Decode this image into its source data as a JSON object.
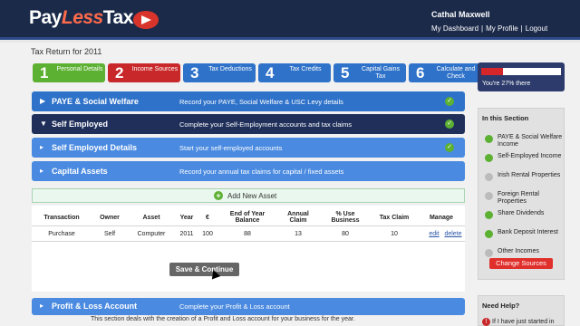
{
  "brand": {
    "pay": "Pay",
    "less": "Less",
    "tax": "Tax"
  },
  "user": {
    "name": "Cathal Maxwell",
    "links": [
      "My Dashboard",
      "My Profile",
      "Logout"
    ],
    "sep": "|"
  },
  "page": {
    "title": "Tax Return for 2011"
  },
  "steps": [
    {
      "num": "1",
      "label": "Personal Details",
      "color": "#5cb032"
    },
    {
      "num": "2",
      "label": "Income Sources",
      "color": "#c9282a"
    },
    {
      "num": "3",
      "label": "Tax Deductions",
      "color": "#2f72c9"
    },
    {
      "num": "4",
      "label": "Tax Credits",
      "color": "#2f72c9"
    },
    {
      "num": "5",
      "label": "Capital Gains Tax",
      "color": "#2f72c9"
    },
    {
      "num": "6",
      "label": "Calculate and Check",
      "color": "#2f72c9"
    }
  ],
  "progress": {
    "text": "You're 27% there",
    "percent": 27
  },
  "sections": {
    "paye": {
      "name": "PAYE & Social Welfare",
      "desc": "Record your PAYE, Social Welfare & USC Levy details"
    },
    "self_employed": {
      "name": "Self Employed",
      "desc": "Complete your Self-Employment accounts and tax claims"
    },
    "self_employed_details": {
      "name": "Self Employed Details",
      "desc": "Start your self-employed accounts"
    },
    "capital_assets": {
      "name": "Capital Assets",
      "desc": "Record your annual tax claims for capital / fixed assets"
    },
    "profit_loss": {
      "name": "Profit & Loss Account",
      "desc": "Complete your Profit & Loss account"
    }
  },
  "add_asset": {
    "label": "Add New Asset"
  },
  "table": {
    "headers": [
      "Transaction",
      "Owner",
      "Asset",
      "Year",
      "€",
      "End of Year Balance",
      "Annual Claim",
      "% Use Business",
      "Tax Claim",
      "Manage"
    ],
    "rows": [
      {
        "transaction": "Purchase",
        "owner": "Self",
        "asset": "Computer",
        "year": "2011",
        "amount": "100",
        "balance": "88",
        "claim": "13",
        "use": "80",
        "tax_claim": "10",
        "edit": "edit",
        "delete": "delete"
      }
    ]
  },
  "save": {
    "label": "Save & Continue"
  },
  "sidebar": {
    "title": "In this Section",
    "items": [
      {
        "label": "PAYE & Social Welfare Income",
        "status": "green"
      },
      {
        "label": "Self-Employed Income",
        "status": "green"
      },
      {
        "label": "Irish Rental Properties",
        "status": "gray"
      },
      {
        "label": "Foreign Rental Properties",
        "status": "gray"
      },
      {
        "label": "Share Dividends",
        "status": "green"
      },
      {
        "label": "Bank Deposit Interest",
        "status": "green"
      },
      {
        "label": "Other Incomes",
        "status": "gray"
      }
    ],
    "change_label": "Change Sources"
  },
  "help": {
    "title": "Need Help?",
    "note": "If I have just started in"
  },
  "pl_desc": "This section deals with the creation of a Profit and Loss account for your business for the year."
}
